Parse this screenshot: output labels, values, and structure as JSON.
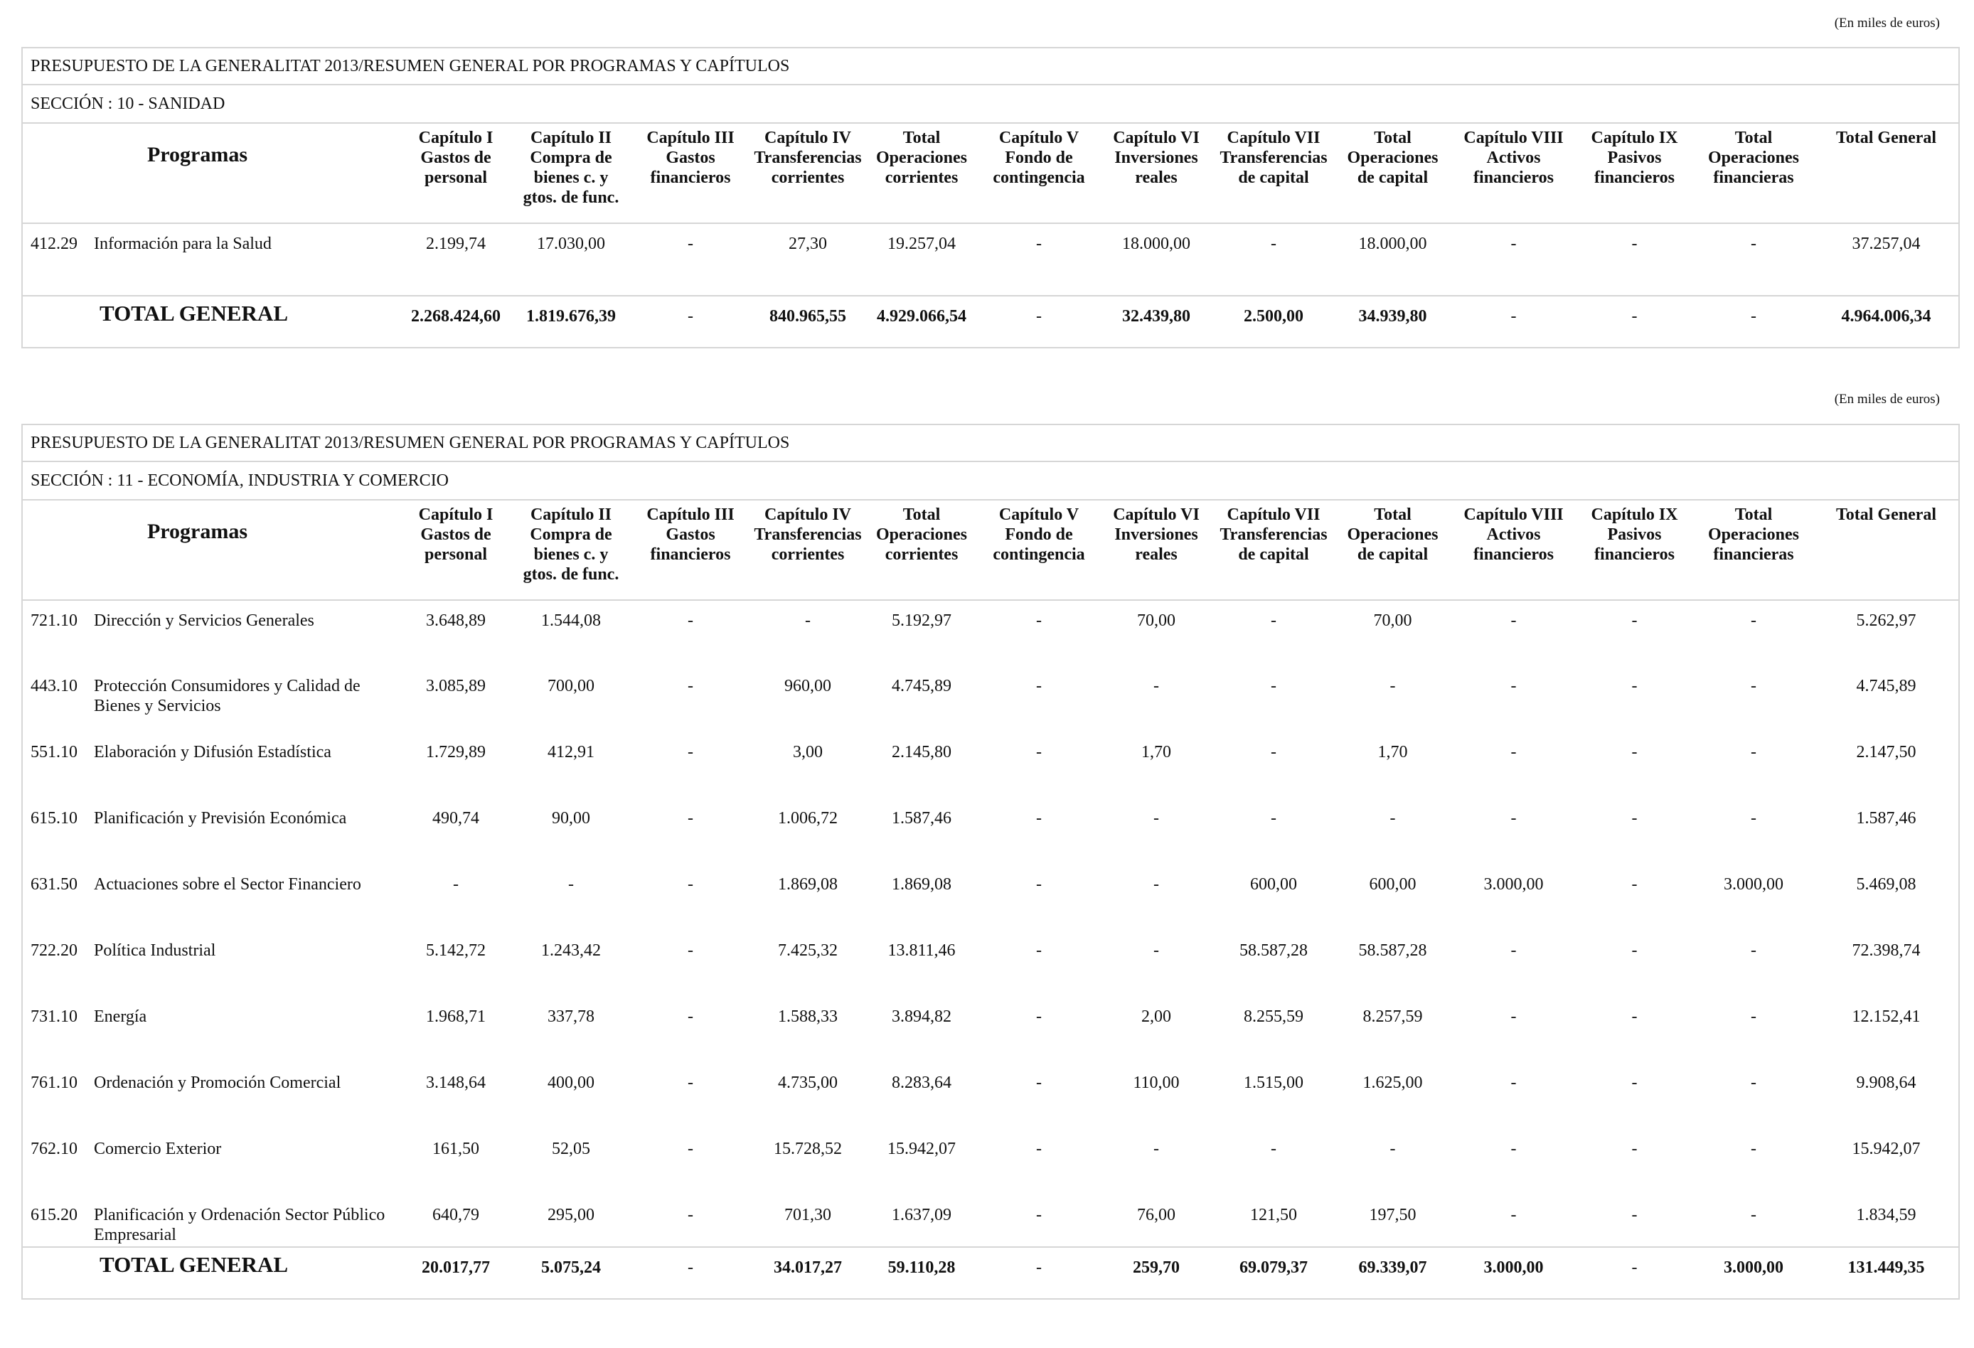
{
  "units_label": "(En miles de euros)",
  "columns": [
    "Programas",
    "Capítulo I\nGastos de\npersonal",
    "Capítulo II\nCompra de\nbienes c. y\ngtos. de func.",
    "Capítulo III\nGastos\nfinancieros",
    "Capítulo IV\nTransferencias\ncorrientes",
    "Total\nOperaciones\ncorrientes",
    "Capítulo V\nFondo de\ncontingencia",
    "Capítulo VI\nInversiones\nreales",
    "Capítulo VII\nTransferencias\nde capital",
    "Total\nOperaciones\nde capital",
    "Capítulo VIII\nActivos\nfinancieros",
    "Capítulo IX\nPasivos\nfinancieros",
    "Total\nOperaciones\nfinancieras",
    "Total General"
  ],
  "blocks": [
    {
      "title": "PRESUPUESTO DE LA GENERALITAT 2013/RESUMEN GENERAL POR PROGRAMAS Y CAPÍTULOS",
      "section": "SECCIÓN : 10  -  SANIDAD",
      "rows": [
        {
          "code": "412.29",
          "name": "Información para la Salud",
          "values": [
            "2.199,74",
            "17.030,00",
            "-",
            "27,30",
            "19.257,04",
            "-",
            "18.000,00",
            "-",
            "18.000,00",
            "-",
            "-",
            "-",
            "37.257,04"
          ]
        }
      ],
      "total": {
        "label": "TOTAL GENERAL",
        "values": [
          "2.268.424,60",
          "1.819.676,39",
          "-",
          "840.965,55",
          "4.929.066,54",
          "-",
          "32.439,80",
          "2.500,00",
          "34.939,80",
          "-",
          "-",
          "-",
          "4.964.006,34"
        ]
      }
    },
    {
      "title": "PRESUPUESTO DE LA GENERALITAT 2013/RESUMEN GENERAL POR PROGRAMAS Y CAPÍTULOS",
      "section": "SECCIÓN : 11  -  ECONOMÍA, INDUSTRIA Y COMERCIO",
      "rows": [
        {
          "code": "721.10",
          "name": "Dirección y Servicios Generales",
          "values": [
            "3.648,89",
            "1.544,08",
            "-",
            "-",
            "5.192,97",
            "-",
            "70,00",
            "-",
            "70,00",
            "-",
            "-",
            "-",
            "5.262,97"
          ]
        },
        {
          "code": "443.10",
          "name": "Protección Consumidores y Calidad de Bienes y Servicios",
          "values": [
            "3.085,89",
            "700,00",
            "-",
            "960,00",
            "4.745,89",
            "-",
            "-",
            "-",
            "-",
            "-",
            "-",
            "-",
            "4.745,89"
          ]
        },
        {
          "code": "551.10",
          "name": "Elaboración y Difusión Estadística",
          "values": [
            "1.729,89",
            "412,91",
            "-",
            "3,00",
            "2.145,80",
            "-",
            "1,70",
            "-",
            "1,70",
            "-",
            "-",
            "-",
            "2.147,50"
          ]
        },
        {
          "code": "615.10",
          "name": "Planificación y Previsión Económica",
          "values": [
            "490,74",
            "90,00",
            "-",
            "1.006,72",
            "1.587,46",
            "-",
            "-",
            "-",
            "-",
            "-",
            "-",
            "-",
            "1.587,46"
          ]
        },
        {
          "code": "631.50",
          "name": "Actuaciones sobre el Sector Financiero",
          "values": [
            "-",
            "-",
            "-",
            "1.869,08",
            "1.869,08",
            "-",
            "-",
            "600,00",
            "600,00",
            "3.000,00",
            "-",
            "3.000,00",
            "5.469,08"
          ]
        },
        {
          "code": "722.20",
          "name": "Política Industrial",
          "values": [
            "5.142,72",
            "1.243,42",
            "-",
            "7.425,32",
            "13.811,46",
            "-",
            "-",
            "58.587,28",
            "58.587,28",
            "-",
            "-",
            "-",
            "72.398,74"
          ]
        },
        {
          "code": "731.10",
          "name": "Energía",
          "values": [
            "1.968,71",
            "337,78",
            "-",
            "1.588,33",
            "3.894,82",
            "-",
            "2,00",
            "8.255,59",
            "8.257,59",
            "-",
            "-",
            "-",
            "12.152,41"
          ]
        },
        {
          "code": "761.10",
          "name": "Ordenación y Promoción Comercial",
          "values": [
            "3.148,64",
            "400,00",
            "-",
            "4.735,00",
            "8.283,64",
            "-",
            "110,00",
            "1.515,00",
            "1.625,00",
            "-",
            "-",
            "-",
            "9.908,64"
          ]
        },
        {
          "code": "762.10",
          "name": "Comercio Exterior",
          "values": [
            "161,50",
            "52,05",
            "-",
            "15.728,52",
            "15.942,07",
            "-",
            "-",
            "-",
            "-",
            "-",
            "-",
            "-",
            "15.942,07"
          ]
        },
        {
          "code": "615.20",
          "name": "Planificación y Ordenación Sector Público Empresarial",
          "values": [
            "640,79",
            "295,00",
            "-",
            "701,30",
            "1.637,09",
            "-",
            "76,00",
            "121,50",
            "197,50",
            "-",
            "-",
            "-",
            "1.834,59"
          ]
        }
      ],
      "total": {
        "label": "TOTAL GENERAL",
        "values": [
          "20.017,77",
          "5.075,24",
          "-",
          "34.017,27",
          "59.110,28",
          "-",
          "259,70",
          "69.079,37",
          "69.339,07",
          "3.000,00",
          "-",
          "3.000,00",
          "131.449,35"
        ]
      }
    }
  ]
}
